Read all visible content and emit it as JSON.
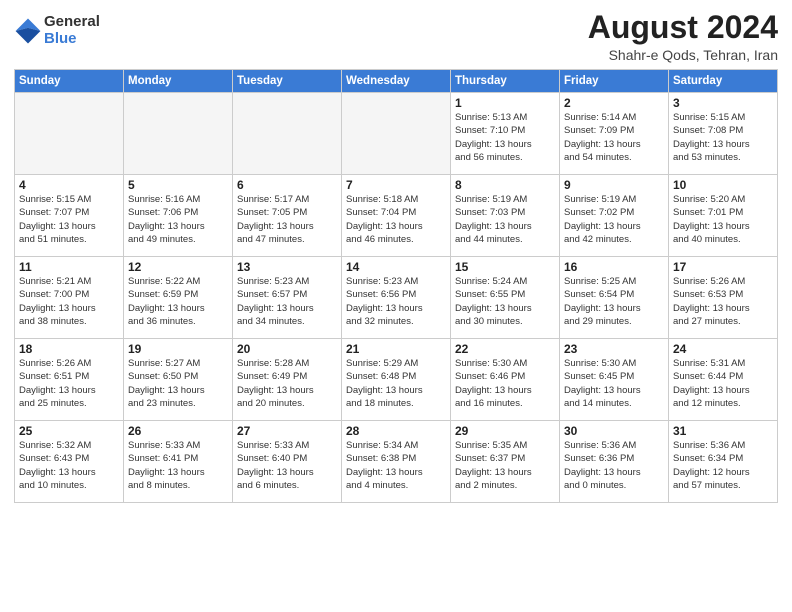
{
  "header": {
    "logo_general": "General",
    "logo_blue": "Blue",
    "month_year": "August 2024",
    "location": "Shahr-e Qods, Tehran, Iran"
  },
  "weekdays": [
    "Sunday",
    "Monday",
    "Tuesday",
    "Wednesday",
    "Thursday",
    "Friday",
    "Saturday"
  ],
  "weeks": [
    [
      {
        "day": "",
        "info": "",
        "empty": true
      },
      {
        "day": "",
        "info": "",
        "empty": true
      },
      {
        "day": "",
        "info": "",
        "empty": true
      },
      {
        "day": "",
        "info": "",
        "empty": true
      },
      {
        "day": "1",
        "info": "Sunrise: 5:13 AM\nSunset: 7:10 PM\nDaylight: 13 hours\nand 56 minutes.",
        "empty": false
      },
      {
        "day": "2",
        "info": "Sunrise: 5:14 AM\nSunset: 7:09 PM\nDaylight: 13 hours\nand 54 minutes.",
        "empty": false
      },
      {
        "day": "3",
        "info": "Sunrise: 5:15 AM\nSunset: 7:08 PM\nDaylight: 13 hours\nand 53 minutes.",
        "empty": false
      }
    ],
    [
      {
        "day": "4",
        "info": "Sunrise: 5:15 AM\nSunset: 7:07 PM\nDaylight: 13 hours\nand 51 minutes.",
        "empty": false
      },
      {
        "day": "5",
        "info": "Sunrise: 5:16 AM\nSunset: 7:06 PM\nDaylight: 13 hours\nand 49 minutes.",
        "empty": false
      },
      {
        "day": "6",
        "info": "Sunrise: 5:17 AM\nSunset: 7:05 PM\nDaylight: 13 hours\nand 47 minutes.",
        "empty": false
      },
      {
        "day": "7",
        "info": "Sunrise: 5:18 AM\nSunset: 7:04 PM\nDaylight: 13 hours\nand 46 minutes.",
        "empty": false
      },
      {
        "day": "8",
        "info": "Sunrise: 5:19 AM\nSunset: 7:03 PM\nDaylight: 13 hours\nand 44 minutes.",
        "empty": false
      },
      {
        "day": "9",
        "info": "Sunrise: 5:19 AM\nSunset: 7:02 PM\nDaylight: 13 hours\nand 42 minutes.",
        "empty": false
      },
      {
        "day": "10",
        "info": "Sunrise: 5:20 AM\nSunset: 7:01 PM\nDaylight: 13 hours\nand 40 minutes.",
        "empty": false
      }
    ],
    [
      {
        "day": "11",
        "info": "Sunrise: 5:21 AM\nSunset: 7:00 PM\nDaylight: 13 hours\nand 38 minutes.",
        "empty": false
      },
      {
        "day": "12",
        "info": "Sunrise: 5:22 AM\nSunset: 6:59 PM\nDaylight: 13 hours\nand 36 minutes.",
        "empty": false
      },
      {
        "day": "13",
        "info": "Sunrise: 5:23 AM\nSunset: 6:57 PM\nDaylight: 13 hours\nand 34 minutes.",
        "empty": false
      },
      {
        "day": "14",
        "info": "Sunrise: 5:23 AM\nSunset: 6:56 PM\nDaylight: 13 hours\nand 32 minutes.",
        "empty": false
      },
      {
        "day": "15",
        "info": "Sunrise: 5:24 AM\nSunset: 6:55 PM\nDaylight: 13 hours\nand 30 minutes.",
        "empty": false
      },
      {
        "day": "16",
        "info": "Sunrise: 5:25 AM\nSunset: 6:54 PM\nDaylight: 13 hours\nand 29 minutes.",
        "empty": false
      },
      {
        "day": "17",
        "info": "Sunrise: 5:26 AM\nSunset: 6:53 PM\nDaylight: 13 hours\nand 27 minutes.",
        "empty": false
      }
    ],
    [
      {
        "day": "18",
        "info": "Sunrise: 5:26 AM\nSunset: 6:51 PM\nDaylight: 13 hours\nand 25 minutes.",
        "empty": false
      },
      {
        "day": "19",
        "info": "Sunrise: 5:27 AM\nSunset: 6:50 PM\nDaylight: 13 hours\nand 23 minutes.",
        "empty": false
      },
      {
        "day": "20",
        "info": "Sunrise: 5:28 AM\nSunset: 6:49 PM\nDaylight: 13 hours\nand 20 minutes.",
        "empty": false
      },
      {
        "day": "21",
        "info": "Sunrise: 5:29 AM\nSunset: 6:48 PM\nDaylight: 13 hours\nand 18 minutes.",
        "empty": false
      },
      {
        "day": "22",
        "info": "Sunrise: 5:30 AM\nSunset: 6:46 PM\nDaylight: 13 hours\nand 16 minutes.",
        "empty": false
      },
      {
        "day": "23",
        "info": "Sunrise: 5:30 AM\nSunset: 6:45 PM\nDaylight: 13 hours\nand 14 minutes.",
        "empty": false
      },
      {
        "day": "24",
        "info": "Sunrise: 5:31 AM\nSunset: 6:44 PM\nDaylight: 13 hours\nand 12 minutes.",
        "empty": false
      }
    ],
    [
      {
        "day": "25",
        "info": "Sunrise: 5:32 AM\nSunset: 6:43 PM\nDaylight: 13 hours\nand 10 minutes.",
        "empty": false
      },
      {
        "day": "26",
        "info": "Sunrise: 5:33 AM\nSunset: 6:41 PM\nDaylight: 13 hours\nand 8 minutes.",
        "empty": false
      },
      {
        "day": "27",
        "info": "Sunrise: 5:33 AM\nSunset: 6:40 PM\nDaylight: 13 hours\nand 6 minutes.",
        "empty": false
      },
      {
        "day": "28",
        "info": "Sunrise: 5:34 AM\nSunset: 6:38 PM\nDaylight: 13 hours\nand 4 minutes.",
        "empty": false
      },
      {
        "day": "29",
        "info": "Sunrise: 5:35 AM\nSunset: 6:37 PM\nDaylight: 13 hours\nand 2 minutes.",
        "empty": false
      },
      {
        "day": "30",
        "info": "Sunrise: 5:36 AM\nSunset: 6:36 PM\nDaylight: 13 hours\nand 0 minutes.",
        "empty": false
      },
      {
        "day": "31",
        "info": "Sunrise: 5:36 AM\nSunset: 6:34 PM\nDaylight: 12 hours\nand 57 minutes.",
        "empty": false
      }
    ]
  ]
}
